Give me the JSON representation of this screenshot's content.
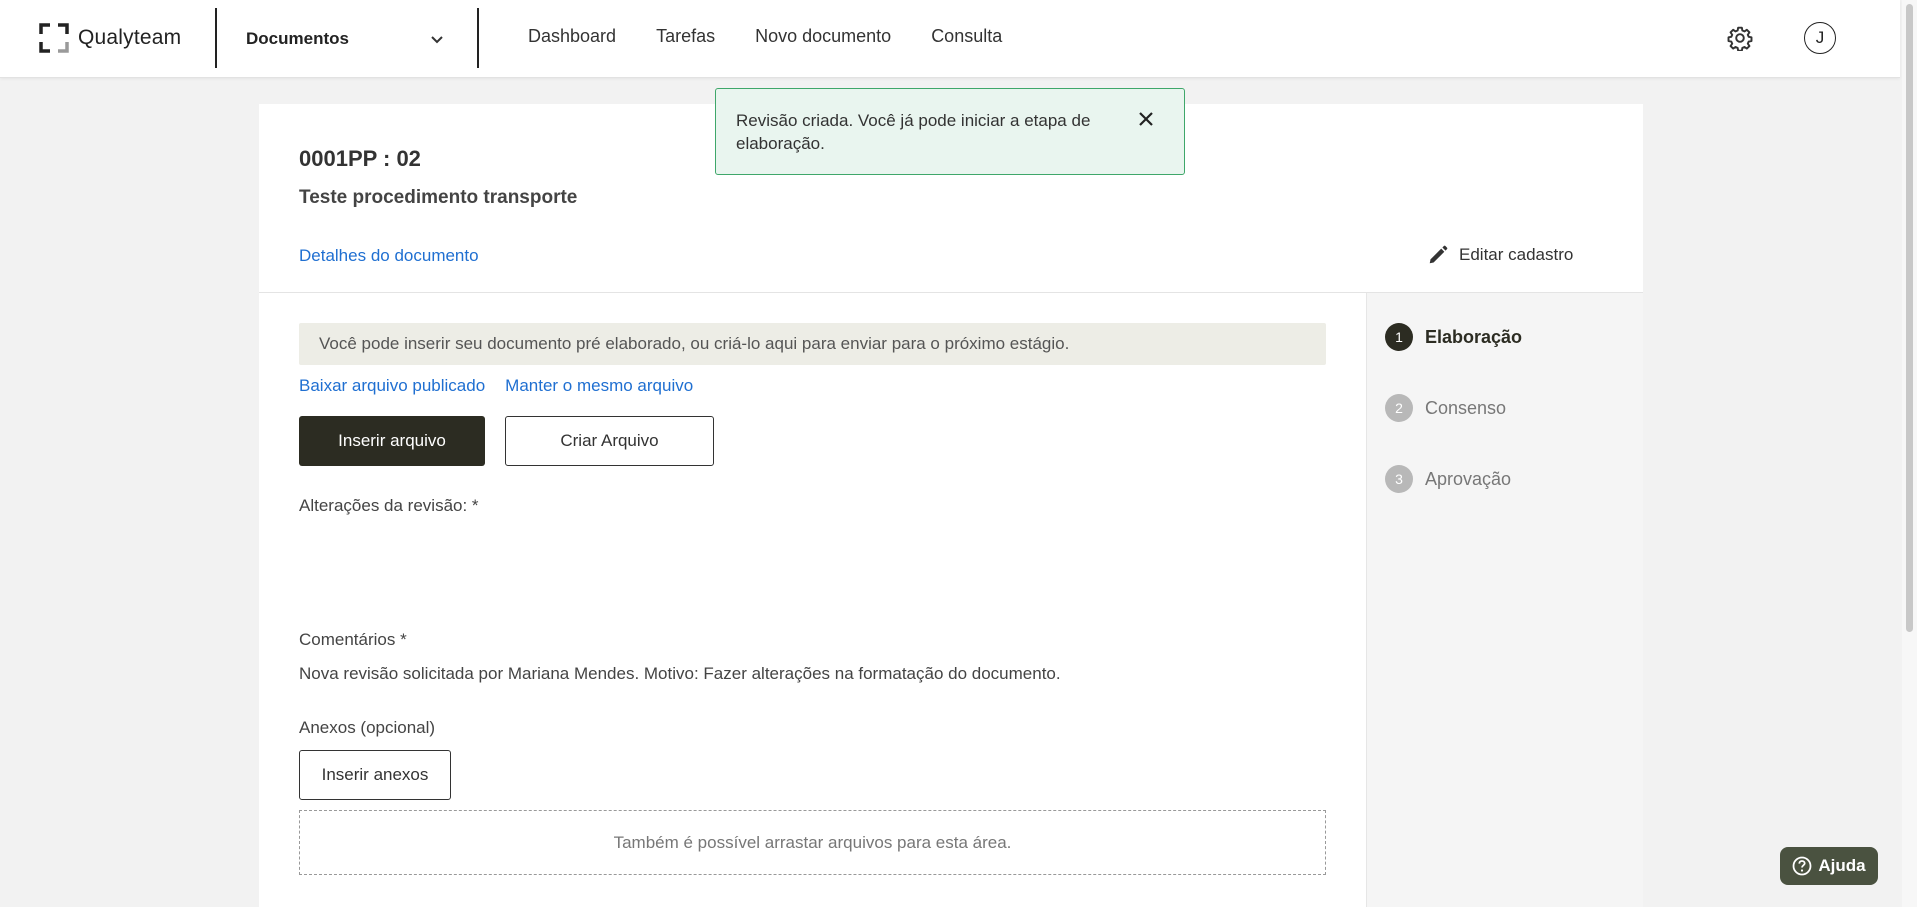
{
  "header": {
    "logo_text": "Qualyteam",
    "module": "Documentos",
    "nav": [
      "Dashboard",
      "Tarefas",
      "Novo documento",
      "Consulta"
    ],
    "avatar_initial": "J"
  },
  "toast": {
    "message": "Revisão criada. Você já pode iniciar a etapa de elaboração."
  },
  "document": {
    "code": "0001PP : 02",
    "title": "Teste procedimento transporte",
    "details_link": "Detalhes do documento",
    "edit_label": "Editar cadastro"
  },
  "form": {
    "info": "Você pode inserir seu documento pré elaborado, ou criá-lo aqui para enviar para o próximo estágio.",
    "download_link": "Baixar arquivo publicado",
    "keep_link": "Manter o mesmo arquivo",
    "insert_file_button": "Inserir arquivo",
    "create_file_button": "Criar Arquivo",
    "changes_label": "Alterações da revisão: *",
    "comments_label": "Comentários *",
    "comments_value": "Nova revisão solicitada por Mariana Mendes. Motivo: Fazer alterações na formatação do documento.",
    "attachments_label": "Anexos (opcional)",
    "insert_attachments_button": "Inserir anexos",
    "dropzone_text": "Também é possível arrastar arquivos para esta área."
  },
  "stepper": [
    {
      "num": "1",
      "label": "Elaboração",
      "active": true
    },
    {
      "num": "2",
      "label": "Consenso",
      "active": false
    },
    {
      "num": "3",
      "label": "Aprovação",
      "active": false
    }
  ],
  "help": {
    "label": "Ajuda"
  },
  "colors": {
    "accent_dark": "#2c2c22",
    "link_blue": "#1f6fd1",
    "toast_border": "#3fa76a",
    "toast_bg": "#e9f5ef"
  }
}
